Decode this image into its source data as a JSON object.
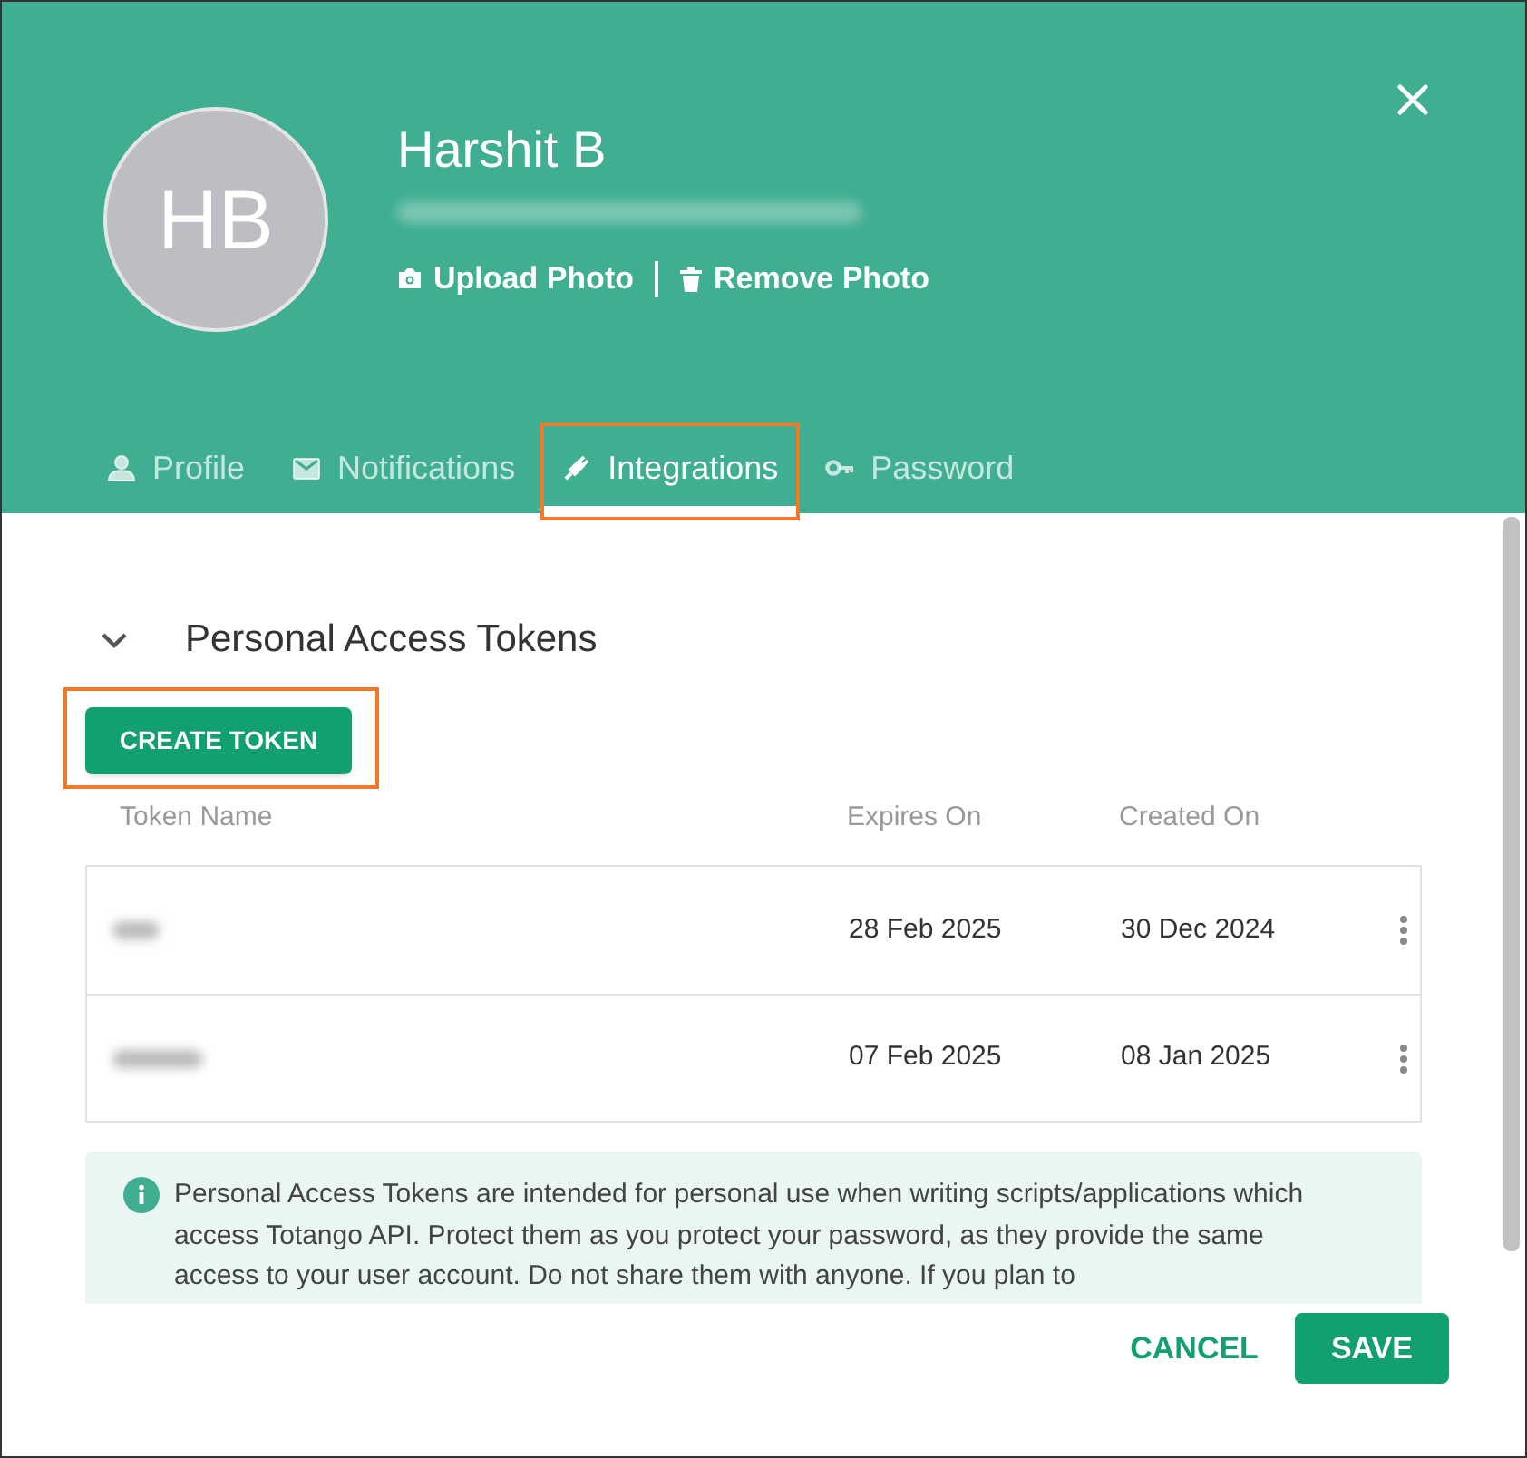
{
  "profile": {
    "initials": "HB",
    "name": "Harshit B",
    "actions": [
      {
        "kind": "upload",
        "label": "Upload Photo"
      },
      {
        "kind": "remove",
        "label": "Remove Photo"
      }
    ]
  },
  "tabs": [
    {
      "kind": "person",
      "label": "Profile",
      "selected": false,
      "highlighted": false
    },
    {
      "kind": "mail",
      "label": "Notifications",
      "selected": false,
      "highlighted": false
    },
    {
      "kind": "plug",
      "label": "Integrations",
      "selected": true,
      "highlighted": true
    },
    {
      "kind": "key",
      "label": "Password",
      "selected": false,
      "highlighted": false
    }
  ],
  "section": {
    "title": "Personal Access Tokens",
    "expanded": true
  },
  "create_button": {
    "label": "CREATE TOKEN",
    "highlighted": true
  },
  "table": {
    "columns": [
      "Token Name",
      "Expires On",
      "Created On"
    ],
    "rows": [
      {
        "expires": "28 Feb 2025",
        "created": "30 Dec 2024"
      },
      {
        "expires": "07 Feb 2025",
        "created": "08 Jan 2025"
      }
    ]
  },
  "info": "Personal Access Tokens are intended for personal use when writing scripts/applications which access Totango API. Protect them as you protect your password, as they provide the same access to your user account. Do not share them with anyone. If you plan to",
  "buttons": [
    {
      "kind": "text",
      "label": "CANCEL"
    },
    {
      "kind": "filled",
      "label": "SAVE"
    }
  ]
}
